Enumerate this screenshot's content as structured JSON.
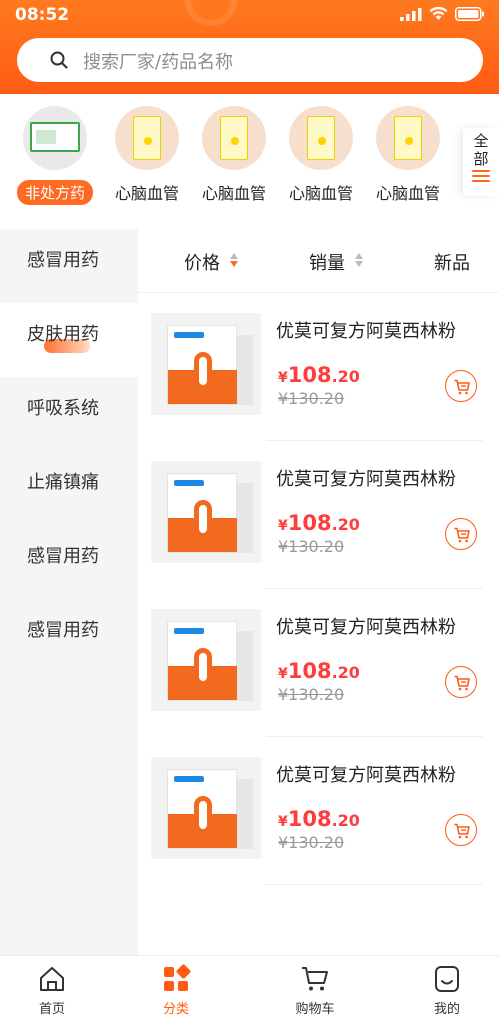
{
  "status": {
    "time": "08:52"
  },
  "search": {
    "placeholder": "搜索厂家/药品名称"
  },
  "brands": [
    {
      "label": "非处方药",
      "active": true
    },
    {
      "label": "心脑血管",
      "active": false
    },
    {
      "label": "心脑血管",
      "active": false
    },
    {
      "label": "心脑血管",
      "active": false
    },
    {
      "label": "心脑血管",
      "active": false
    }
  ],
  "all_button": {
    "label": "全部"
  },
  "categories": [
    {
      "label": "感冒用药"
    },
    {
      "label": "皮肤用药"
    },
    {
      "label": "呼吸系统"
    },
    {
      "label": "止痛镇痛"
    },
    {
      "label": "感冒用药"
    },
    {
      "label": "感冒用药"
    }
  ],
  "sort": {
    "price": "价格",
    "sales": "销量",
    "new": "新品"
  },
  "products": [
    {
      "name": "优莫可复方阿莫西林粉",
      "currency": "¥",
      "price_int": "108",
      "price_dec": ".20",
      "old_price": "¥130.20"
    },
    {
      "name": "优莫可复方阿莫西林粉",
      "currency": "¥",
      "price_int": "108",
      "price_dec": ".20",
      "old_price": "¥130.20"
    },
    {
      "name": "优莫可复方阿莫西林粉",
      "currency": "¥",
      "price_int": "108",
      "price_dec": ".20",
      "old_price": "¥130.20"
    },
    {
      "name": "优莫可复方阿莫西林粉",
      "currency": "¥",
      "price_int": "108",
      "price_dec": ".20",
      "old_price": "¥130.20"
    }
  ],
  "nav": [
    {
      "label": "首页",
      "icon": "home-icon"
    },
    {
      "label": "分类",
      "icon": "category-icon",
      "active": true
    },
    {
      "label": "购物车",
      "icon": "cart-icon"
    },
    {
      "label": "我的",
      "icon": "profile-icon"
    }
  ],
  "colors": {
    "accent": "#ff5b14",
    "price": "#ff3d3d"
  }
}
